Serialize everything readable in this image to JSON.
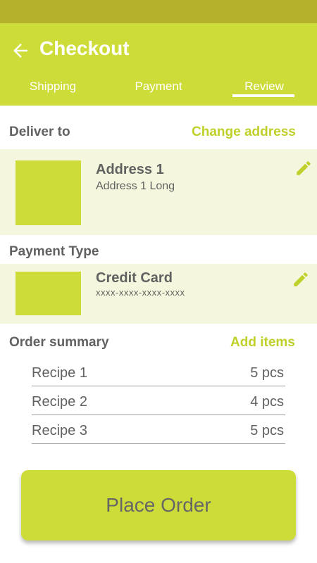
{
  "header": {
    "title": "Checkout",
    "tabs": [
      {
        "label": "Shipping"
      },
      {
        "label": "Payment"
      },
      {
        "label": "Review",
        "active": true
      }
    ]
  },
  "deliver": {
    "label": "Deliver to",
    "change_link": "Change address",
    "address_title": "Address 1",
    "address_long": "Address 1 Long"
  },
  "payment": {
    "label": "Payment Type",
    "method": "Credit Card",
    "number": "xxxx-xxxx-xxxx-xxxx"
  },
  "summary": {
    "label": "Order summary",
    "add_link": "Add items",
    "items": [
      {
        "name": "Recipe 1",
        "qty": "5 pcs"
      },
      {
        "name": "Recipe 2",
        "qty": "4 pcs"
      },
      {
        "name": "Recipe 3",
        "qty": "5 pcs"
      }
    ]
  },
  "place_order_label": "Place Order",
  "colors": {
    "accent": "#cddc39",
    "status_bar": "#b4b22a",
    "card_bg": "#f4f7dd",
    "link": "#c0d02a"
  },
  "icons": {
    "back": "arrow-back-icon",
    "edit": "pencil-icon"
  }
}
